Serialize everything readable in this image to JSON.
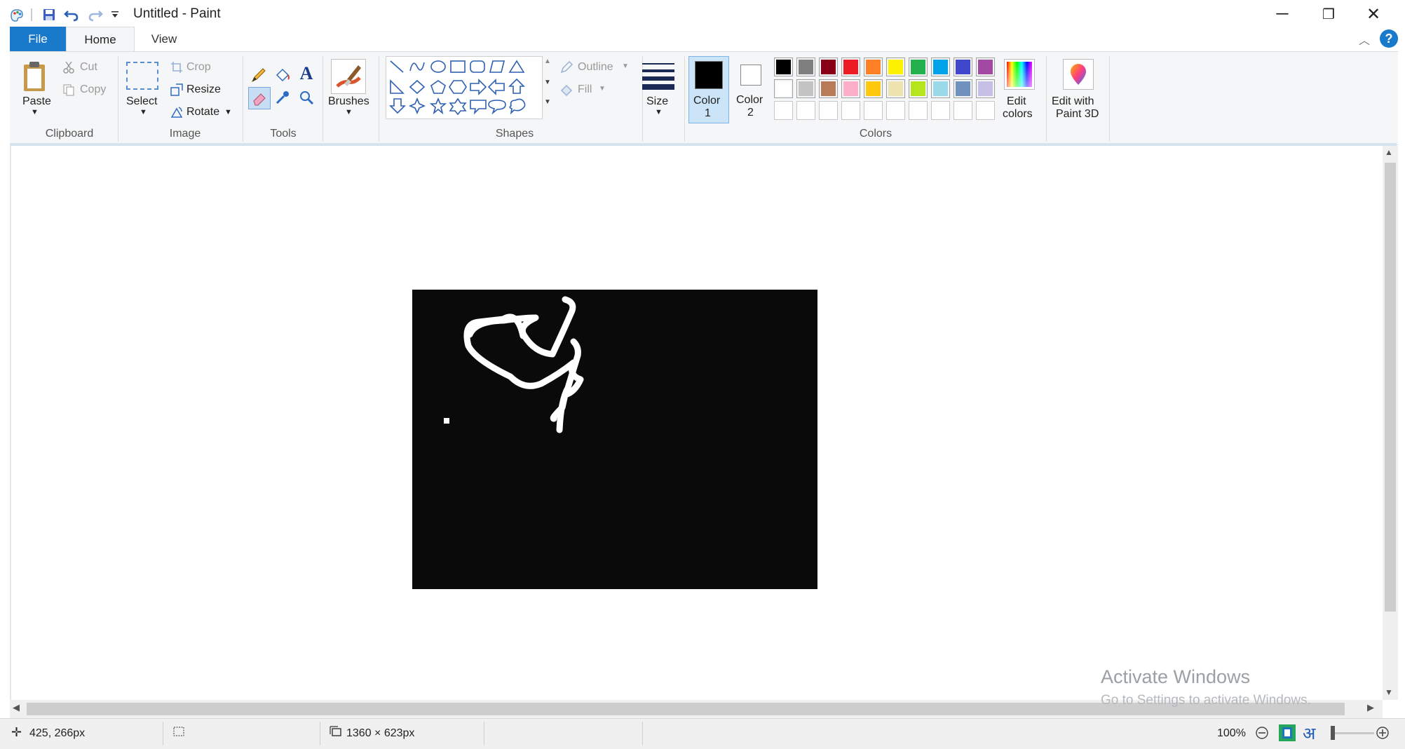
{
  "window": {
    "title": "Untitled - Paint",
    "minimize": "─",
    "maximize": "❐",
    "close": "✕"
  },
  "tabs": [
    "File",
    "Home",
    "View"
  ],
  "ribbon": {
    "clipboard": {
      "paste": "Paste",
      "cut": "Cut",
      "copy": "Copy",
      "label": "Clipboard"
    },
    "image": {
      "select": "Select",
      "crop": "Crop",
      "resize": "Resize",
      "rotate": "Rotate",
      "label": "Image"
    },
    "tools": {
      "label": "Tools"
    },
    "brushes": {
      "label": "Brushes"
    },
    "shapes": {
      "outline": "Outline",
      "fill": "Fill",
      "label": "Shapes"
    },
    "size": {
      "label": "Size"
    },
    "colors": {
      "color1": "Color",
      "color1_num": "1",
      "color2": "Color",
      "color2_num": "2",
      "edit_colors_1": "Edit",
      "edit_colors_2": "colors",
      "label": "Colors",
      "palette_row1": [
        "#000000",
        "#7f7f7f",
        "#880015",
        "#ed1c24",
        "#ff7f27",
        "#fff200",
        "#22b14c",
        "#00a2e8",
        "#3f48cc",
        "#a349a4"
      ],
      "palette_row2": [
        "#ffffff",
        "#c3c3c3",
        "#b97a57",
        "#ffaec9",
        "#ffc90e",
        "#efe4b0",
        "#b5e61d",
        "#99d9ea",
        "#7092be",
        "#c8bfe7"
      ],
      "palette_row3_empty": 10
    },
    "paint3d": {
      "line1": "Edit with",
      "line2": "Paint 3D"
    }
  },
  "status": {
    "cursor_pos": "425, 266px",
    "canvas_size": "1360 × 623px",
    "zoom": "100%"
  },
  "watermark": {
    "line1": "Activate Windows",
    "line2": "Go to Settings to activate Windows."
  },
  "colors": {
    "accent": "#1979ca",
    "ribbon_bg": "#f5f6f7",
    "canvas_fill": "#0a0a0a",
    "stroke": "#ffffff"
  }
}
